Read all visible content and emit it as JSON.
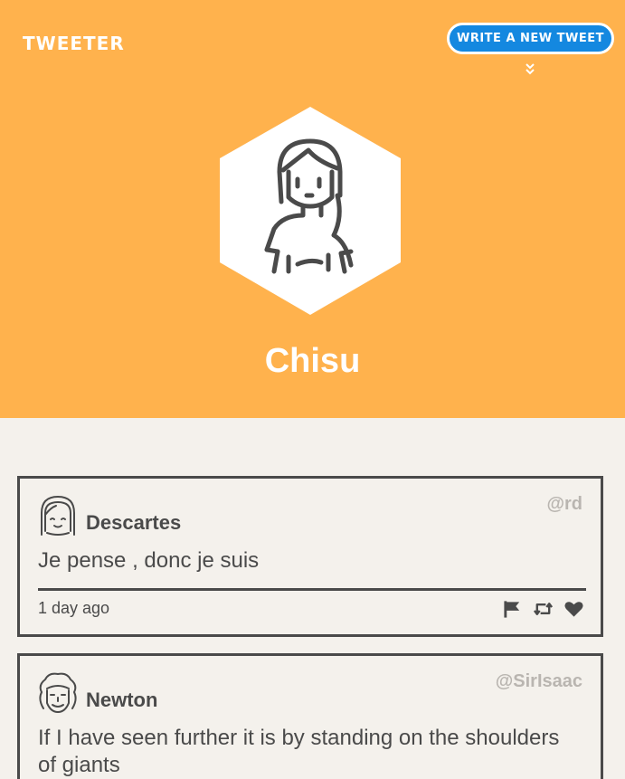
{
  "nav": {
    "brand": "TWEETER",
    "write_button": "WRITE A NEW TWEET",
    "scroll_icon": "double-chevron-down-icon"
  },
  "profile": {
    "name": "Chisu",
    "avatar_icon": "woman-avatar-icon"
  },
  "tweets": [
    {
      "author": "Descartes",
      "handle": "@rd",
      "text": "Je pense , donc je suis",
      "time": "1 day ago",
      "actions": [
        "flag-icon",
        "retweet-icon",
        "heart-icon"
      ]
    },
    {
      "author": "Newton",
      "handle": "@SirIsaac",
      "text": "If I have seen further it is by standing on the shoulders of giants",
      "actions": [
        "flag-icon",
        "retweet-icon",
        "heart-icon"
      ]
    }
  ],
  "colors": {
    "header_bg": "#ffb24d",
    "button_bg": "#1488e0",
    "page_bg": "#f4f1ec",
    "text": "#4a4a4a",
    "handle": "#b9b5b0"
  }
}
